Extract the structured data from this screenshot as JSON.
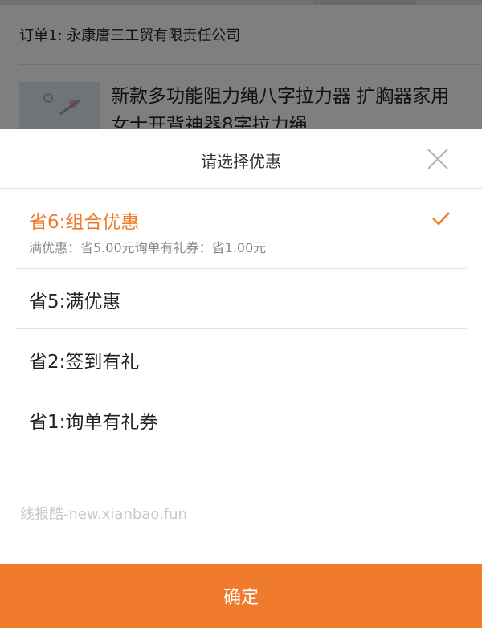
{
  "background": {
    "order_label": "订单1: 永康唐三工贸有限责任公司",
    "product_title": "新款多功能阻力绳八字拉力器 扩胸器家用女士开背神器8字拉力绳"
  },
  "sheet": {
    "title": "请选择优惠",
    "options": [
      {
        "label": "省6:组合优惠",
        "detail": "满优惠：省5.00元询单有礼券：省1.00元",
        "selected": true
      },
      {
        "label": "省5:满优惠",
        "selected": false
      },
      {
        "label": "省2:签到有礼",
        "selected": false
      },
      {
        "label": "省1:询单有礼券",
        "selected": false
      }
    ],
    "watermark": "线报酷-new.xianbao.fun",
    "confirm_label": "确定"
  },
  "colors": {
    "accent": "#f07b2c",
    "selected_text": "#ee7b2b"
  },
  "icons": {
    "close": "close-icon",
    "check": "check-icon"
  }
}
